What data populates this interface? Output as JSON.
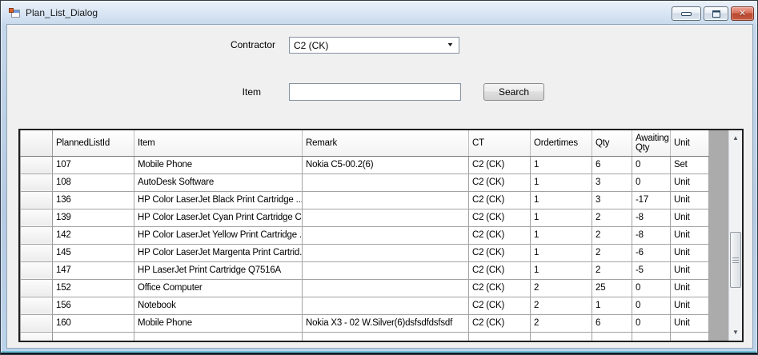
{
  "window": {
    "title": "Plan_List_Dialog"
  },
  "form": {
    "contractor_label": "Contractor",
    "contractor_value": "C2 (CK)",
    "item_label": "Item",
    "item_value": "",
    "search_label": "Search"
  },
  "grid": {
    "columns": [
      "PlannedListId",
      "Item",
      "Remark",
      "CT",
      "Ordertimes",
      "Qty",
      "Awaiting Qty",
      "Unit"
    ],
    "rows": [
      [
        "107",
        "Mobile Phone",
        "Nokia C5-00.2(6)",
        "C2 (CK)",
        "1",
        "6",
        "0",
        "Set"
      ],
      [
        "108",
        "AutoDesk Software",
        "",
        "C2 (CK)",
        "1",
        "3",
        "0",
        "Unit"
      ],
      [
        "136",
        "HP Color LaserJet Black Print Cartridge ...",
        "",
        "C2 (CK)",
        "1",
        "3",
        "-17",
        "Unit"
      ],
      [
        "139",
        "HP Color LaserJet Cyan Print Cartridge C...",
        "",
        "C2 (CK)",
        "1",
        "2",
        "-8",
        "Unit"
      ],
      [
        "142",
        "HP Color LaserJet Yellow Print Cartridge ...",
        "",
        "C2 (CK)",
        "1",
        "2",
        "-8",
        "Unit"
      ],
      [
        "145",
        "HP Color LaserJet Margenta Print Cartrid...",
        "",
        "C2 (CK)",
        "1",
        "2",
        "-6",
        "Unit"
      ],
      [
        "147",
        "HP LaserJet Print Cartridge Q7516A",
        "",
        "C2 (CK)",
        "1",
        "2",
        "-5",
        "Unit"
      ],
      [
        "152",
        "Office Computer",
        "",
        "C2 (CK)",
        "2",
        "25",
        "0",
        "Unit"
      ],
      [
        "156",
        "Notebook",
        "",
        "C2 (CK)",
        "2",
        "1",
        "0",
        "Unit"
      ],
      [
        "160",
        "Mobile Phone",
        "Nokia X3 - 02 W.Silver(6)dsfsdfdsfsdf",
        "C2 (CK)",
        "2",
        "6",
        "0",
        "Unit"
      ]
    ]
  },
  "icons": {
    "chevron_down": "▼",
    "close": "✕",
    "scroll_up": "▲",
    "scroll_down": "▼"
  },
  "colors": {
    "frame_blue": "#bdd3ea",
    "client_bg": "#f0f0f0",
    "grid_filler_gray": "#ababab",
    "grid_border": "#1f1f1f",
    "close_button_red": "#c65a40"
  }
}
